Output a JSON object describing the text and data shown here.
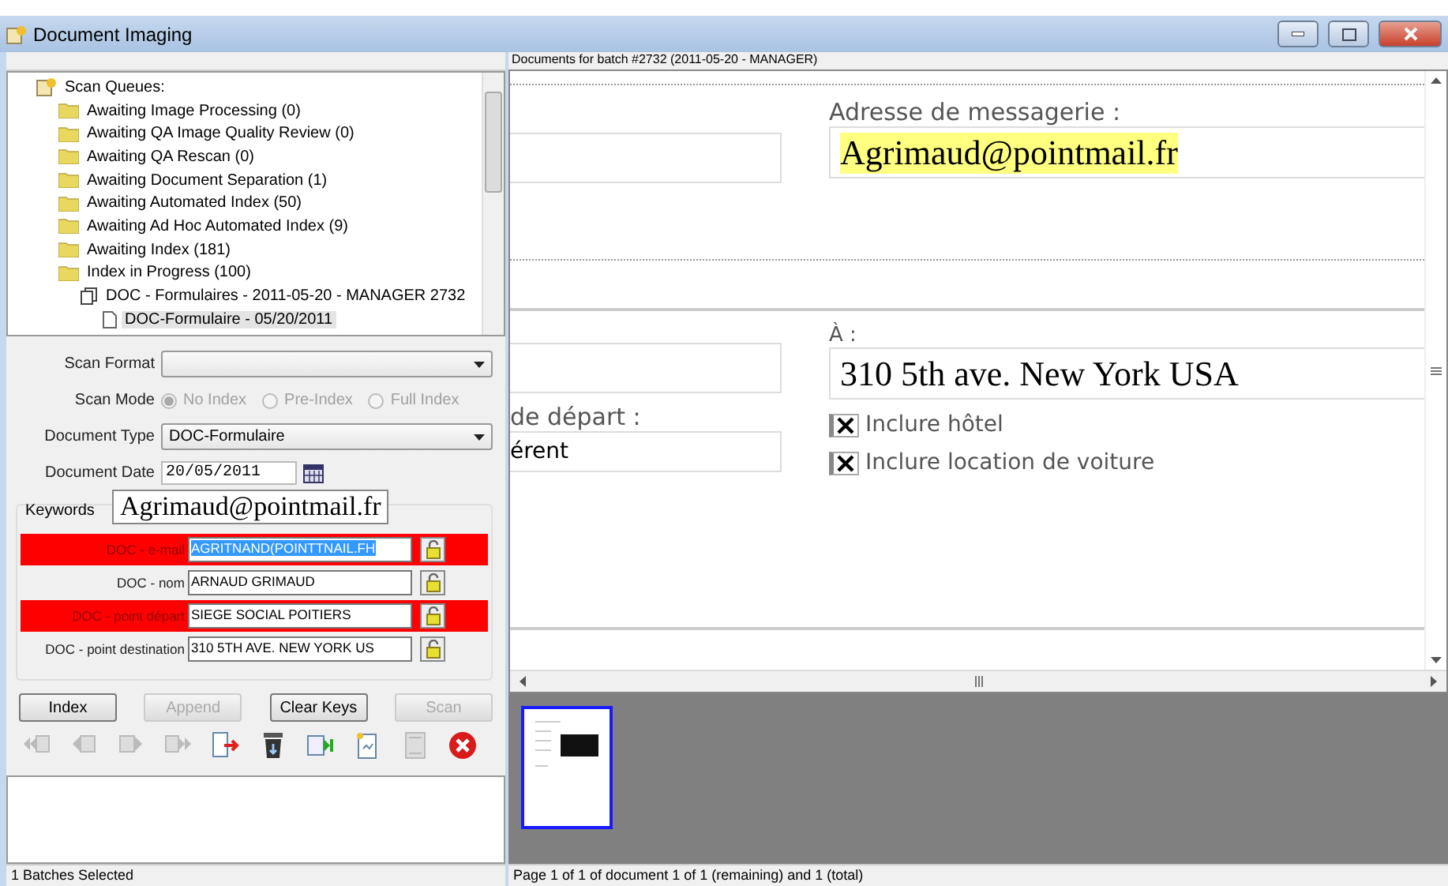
{
  "window": {
    "title": "Document Imaging"
  },
  "tree": {
    "label": "Scan Queues:",
    "selected": false,
    "children": [
      {
        "label": "Awaiting Image Processing (0)",
        "selected": false
      },
      {
        "label": "Awaiting QA Image Quality Review (0)",
        "selected": false
      },
      {
        "label": "Awaiting QA Rescan (0)",
        "selected": false
      },
      {
        "label": "Awaiting Document Separation (1)",
        "selected": false
      },
      {
        "label": "Awaiting Automated Index (50)",
        "selected": false
      },
      {
        "label": "Awaiting Ad Hoc Automated Index (9)",
        "selected": false
      },
      {
        "label": "Awaiting Index (181)",
        "selected": false
      },
      {
        "label": "Index in Progress (100)",
        "selected": false,
        "children": [
          {
            "kind": "batch",
            "label": "DOC - Formulaires - 2011-05-20 - MANAGER 2732",
            "selected": false,
            "children": [
              {
                "kind": "document",
                "label": "DOC-Formulaire - 05/20/2011",
                "selected": true
              }
            ]
          }
        ]
      }
    ]
  },
  "form": {
    "scan_format": {
      "label": "Scan Format"
    },
    "scan_mode": {
      "label": "Scan Mode",
      "options": [
        {
          "label": "No Index",
          "selected": true
        },
        {
          "label": "Pre-Index",
          "selected": false
        },
        {
          "label": "Full Index",
          "selected": false
        }
      ]
    },
    "document_type": {
      "label": "Document Type",
      "value": "DOC-Formulaire"
    },
    "document_date": {
      "label": "Document Date",
      "value": "20/05/2011"
    },
    "keywords": {
      "title": "Keywords",
      "tooltip": "Agrimaud@pointmail.fr",
      "rows": [
        {
          "label": "DOC - e-mail",
          "value": "AGRITNAND(POINTTNAIL.FH",
          "error": true,
          "selected": true
        },
        {
          "label": "DOC - nom",
          "value": "ARNAUD GRIMAUD",
          "error": false,
          "selected": false
        },
        {
          "label": "DOC - point départ",
          "value": "SIEGE SOCIAL POITIERS",
          "error": true,
          "selected": false
        },
        {
          "label": "DOC - point destination",
          "value": "310 5TH AVE. NEW YORK US",
          "error": false,
          "selected": false
        }
      ]
    },
    "buttons": [
      {
        "label": "Index",
        "disabled": false
      },
      {
        "label": "Append",
        "disabled": true
      },
      {
        "label": "Clear Keys",
        "disabled": false
      },
      {
        "label": "Scan",
        "disabled": true
      }
    ]
  },
  "status_left": "1 Batches Selected",
  "viewer": {
    "header": "Documents for batch #2732 (2011-05-20 - MANAGER)",
    "email_label": "Adresse de messagerie :",
    "email_value": "Agrimaud@pointmail.fr",
    "to_label": "À :",
    "to_value": "310 5th ave. New York USA",
    "depart_label": "de départ :",
    "depart_value": "érent",
    "checkboxes": [
      {
        "label": "Inclure hôtel",
        "checked": true
      },
      {
        "label": "Inclure location de voiture",
        "checked": true
      }
    ]
  },
  "thumbnails": [
    {
      "selected": true
    }
  ],
  "status_right": "Page 1 of 1 of document 1 of 1 (remaining) and 1 (total)"
}
